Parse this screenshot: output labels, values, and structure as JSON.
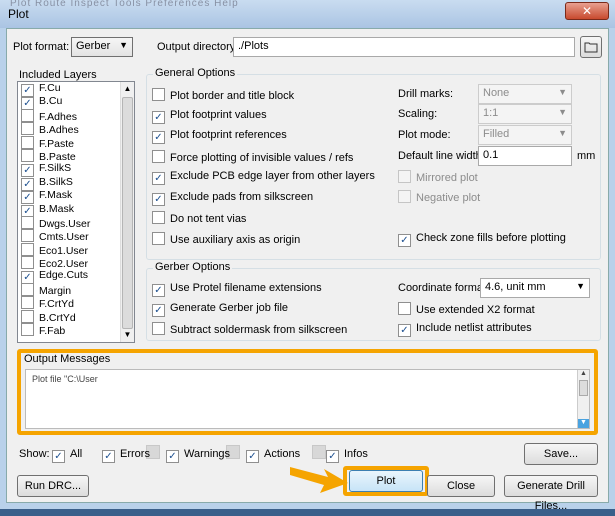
{
  "window": {
    "title": "Plot",
    "menu_ghost": "Plot  Route  Inspect  Tools  Preferences  Help",
    "close_glyph": "✕"
  },
  "header": {
    "plot_format_label": "Plot format:",
    "plot_format_value": "Gerber",
    "output_dir_label": "Output directory:",
    "output_dir_value": "./Plots"
  },
  "layers": {
    "title": "Included Layers",
    "items": [
      {
        "label": "F.Cu",
        "checked": true
      },
      {
        "label": "B.Cu",
        "checked": true
      },
      {
        "label": "F.Adhes",
        "checked": false
      },
      {
        "label": "B.Adhes",
        "checked": false
      },
      {
        "label": "F.Paste",
        "checked": false
      },
      {
        "label": "B.Paste",
        "checked": false
      },
      {
        "label": "F.SilkS",
        "checked": true
      },
      {
        "label": "B.SilkS",
        "checked": true
      },
      {
        "label": "F.Mask",
        "checked": true
      },
      {
        "label": "B.Mask",
        "checked": true
      },
      {
        "label": "Dwgs.User",
        "checked": false
      },
      {
        "label": "Cmts.User",
        "checked": false
      },
      {
        "label": "Eco1.User",
        "checked": false
      },
      {
        "label": "Eco2.User",
        "checked": false
      },
      {
        "label": "Edge.Cuts",
        "checked": true
      },
      {
        "label": "Margin",
        "checked": false
      },
      {
        "label": "F.CrtYd",
        "checked": false
      },
      {
        "label": "B.CrtYd",
        "checked": false
      },
      {
        "label": "F.Fab",
        "checked": false
      }
    ]
  },
  "general": {
    "title": "General Options",
    "options": [
      {
        "label": "Plot border and title block",
        "checked": false
      },
      {
        "label": "Plot footprint values",
        "checked": true
      },
      {
        "label": "Plot footprint references",
        "checked": true
      },
      {
        "label": "Force plotting of invisible values / refs",
        "checked": false
      },
      {
        "label": "Exclude PCB edge layer from other layers",
        "checked": true
      },
      {
        "label": "Exclude pads from silkscreen",
        "checked": true
      },
      {
        "label": "Do not tent vias",
        "checked": false
      },
      {
        "label": "Use auxiliary axis as origin",
        "checked": false
      }
    ],
    "drill_marks_label": "Drill marks:",
    "drill_marks_value": "None",
    "scaling_label": "Scaling:",
    "scaling_value": "1:1",
    "plot_mode_label": "Plot mode:",
    "plot_mode_value": "Filled",
    "line_width_label": "Default line width:",
    "line_width_value": "0.1",
    "line_width_unit": "mm",
    "mirrored_label": "Mirrored plot",
    "negative_label": "Negative plot",
    "zone_fills_label": "Check zone fills before plotting",
    "zone_fills_checked": true
  },
  "gerber": {
    "title": "Gerber Options",
    "options": [
      {
        "label": "Use Protel filename extensions",
        "checked": true
      },
      {
        "label": "Generate Gerber job file",
        "checked": true
      },
      {
        "label": "Subtract soldermask from silkscreen",
        "checked": false
      }
    ],
    "coord_format_label": "Coordinate format:",
    "coord_format_value": "4.6, unit mm",
    "x2_label": "Use extended X2 format",
    "x2_checked": false,
    "netlist_label": "Include netlist attributes",
    "netlist_checked": true
  },
  "output": {
    "title": "Output Messages",
    "message": "Plot file \"C:\\User"
  },
  "show": {
    "label": "Show:",
    "filters": [
      {
        "label": "All",
        "checked": true
      },
      {
        "label": "Errors",
        "checked": true
      },
      {
        "label": "Warnings",
        "checked": true
      },
      {
        "label": "Actions",
        "checked": true
      },
      {
        "label": "Infos",
        "checked": true
      }
    ],
    "save_label": "Save..."
  },
  "buttons": {
    "run_drc": "Run DRC...",
    "plot": "Plot",
    "close": "Close",
    "drill_files": "Generate Drill Files..."
  },
  "colors": {
    "highlight": "#f5a400",
    "check": "#1c4f8f"
  }
}
